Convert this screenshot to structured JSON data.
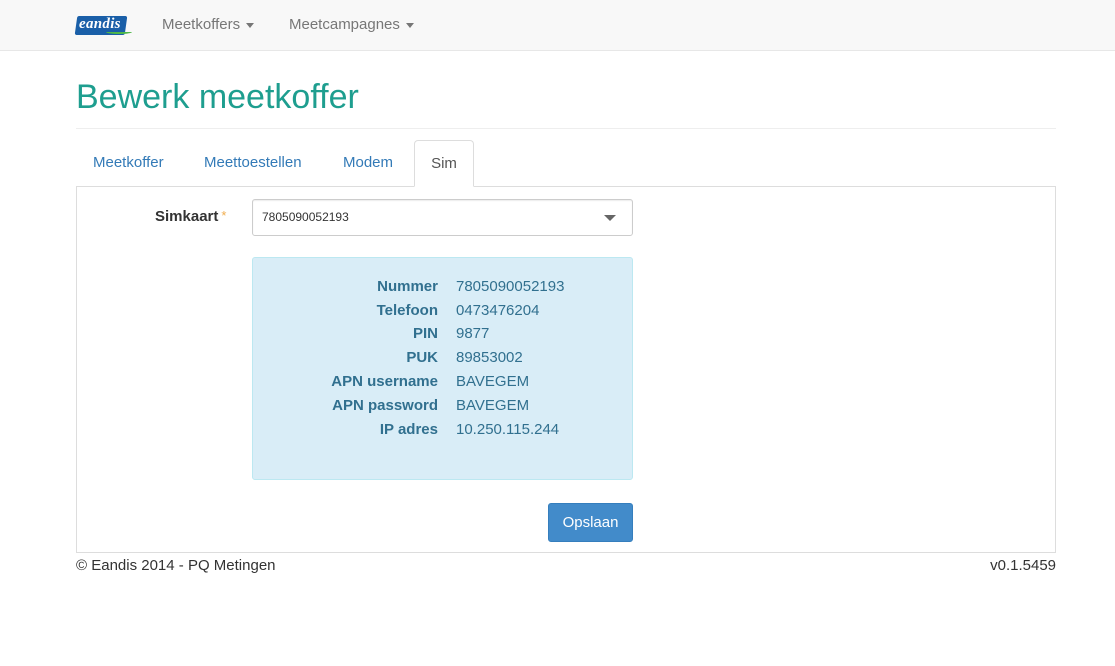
{
  "brand": {
    "logo_text": "eandis"
  },
  "nav": {
    "items": [
      {
        "label": "Meetkoffers"
      },
      {
        "label": "Meetcampagnes"
      }
    ]
  },
  "page": {
    "title": "Bewerk meetkoffer"
  },
  "tabs": [
    {
      "label": "Meetkoffer",
      "active": false
    },
    {
      "label": "Meettoestellen",
      "active": false
    },
    {
      "label": "Modem",
      "active": false
    },
    {
      "label": "Sim",
      "active": true
    }
  ],
  "form": {
    "simkaart_label": "Simkaart",
    "required_mark": "*",
    "simkaart_value": "7805090052193"
  },
  "sim_info": [
    {
      "key": "Nummer",
      "value": "7805090052193"
    },
    {
      "key": "Telefoon",
      "value": "0473476204"
    },
    {
      "key": "PIN",
      "value": "9877"
    },
    {
      "key": "PUK",
      "value": "89853002"
    },
    {
      "key": "APN username",
      "value": "BAVEGEM"
    },
    {
      "key": "APN password",
      "value": "BAVEGEM"
    },
    {
      "key": "IP adres",
      "value": "10.250.115.244"
    }
  ],
  "actions": {
    "save_label": "Opslaan"
  },
  "footer": {
    "copyright": "© Eandis 2014 - PQ Metingen",
    "version": "v0.1.5459"
  },
  "colors": {
    "title": "#1e9e8f",
    "link": "#337ab7",
    "info_bg": "#d9edf7",
    "info_text": "#31708f",
    "primary_button": "#428bca",
    "required": "#f0ad4e"
  }
}
